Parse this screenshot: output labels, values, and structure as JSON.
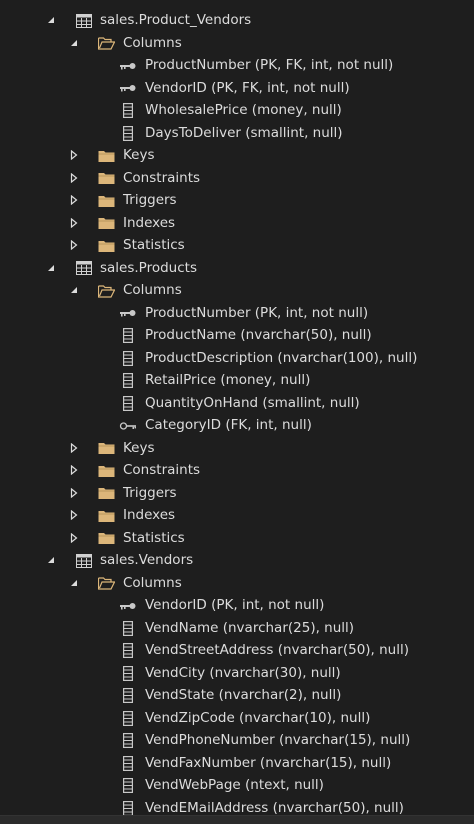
{
  "tables": [
    {
      "name": "sales.Product_Vendors",
      "columns_label": "Columns",
      "columns": [
        {
          "label": "ProductNumber (PK, FK, int, not null)",
          "icon": "key-icon"
        },
        {
          "label": "VendorID (PK, FK, int, not null)",
          "icon": "key-icon"
        },
        {
          "label": "WholesalePrice (money, null)",
          "icon": "column-icon"
        },
        {
          "label": "DaysToDeliver (smallint, null)",
          "icon": "column-icon"
        }
      ],
      "folders": [
        "Keys",
        "Constraints",
        "Triggers",
        "Indexes",
        "Statistics"
      ]
    },
    {
      "name": "sales.Products",
      "columns_label": "Columns",
      "columns": [
        {
          "label": "ProductNumber (PK, int, not null)",
          "icon": "key-icon"
        },
        {
          "label": "ProductName (nvarchar(50), null)",
          "icon": "column-icon"
        },
        {
          "label": "ProductDescription (nvarchar(100), null)",
          "icon": "column-icon"
        },
        {
          "label": "RetailPrice (money, null)",
          "icon": "column-icon"
        },
        {
          "label": "QuantityOnHand (smallint, null)",
          "icon": "column-icon"
        },
        {
          "label": "CategoryID (FK, int, null)",
          "icon": "foreign-key-icon"
        }
      ],
      "folders": [
        "Keys",
        "Constraints",
        "Triggers",
        "Indexes",
        "Statistics"
      ]
    },
    {
      "name": "sales.Vendors",
      "columns_label": "Columns",
      "columns": [
        {
          "label": "VendorID (PK, int, not null)",
          "icon": "key-icon"
        },
        {
          "label": "VendName (nvarchar(25), null)",
          "icon": "column-icon"
        },
        {
          "label": "VendStreetAddress (nvarchar(50), null)",
          "icon": "column-icon"
        },
        {
          "label": "VendCity (nvarchar(30), null)",
          "icon": "column-icon"
        },
        {
          "label": "VendState (nvarchar(2), null)",
          "icon": "column-icon"
        },
        {
          "label": "VendZipCode (nvarchar(10), null)",
          "icon": "column-icon"
        },
        {
          "label": "VendPhoneNumber (nvarchar(15), null)",
          "icon": "column-icon"
        },
        {
          "label": "VendFaxNumber (nvarchar(15), null)",
          "icon": "column-icon"
        },
        {
          "label": "VendWebPage (ntext, null)",
          "icon": "column-icon"
        },
        {
          "label": "VendEMailAddress (nvarchar(50), null)",
          "icon": "column-icon"
        }
      ],
      "folders": []
    }
  ],
  "colors": {
    "background": "#1e1e1e",
    "text": "#dcdcdc",
    "folder": "#dcb67a",
    "icon": "#c8c8c8"
  }
}
